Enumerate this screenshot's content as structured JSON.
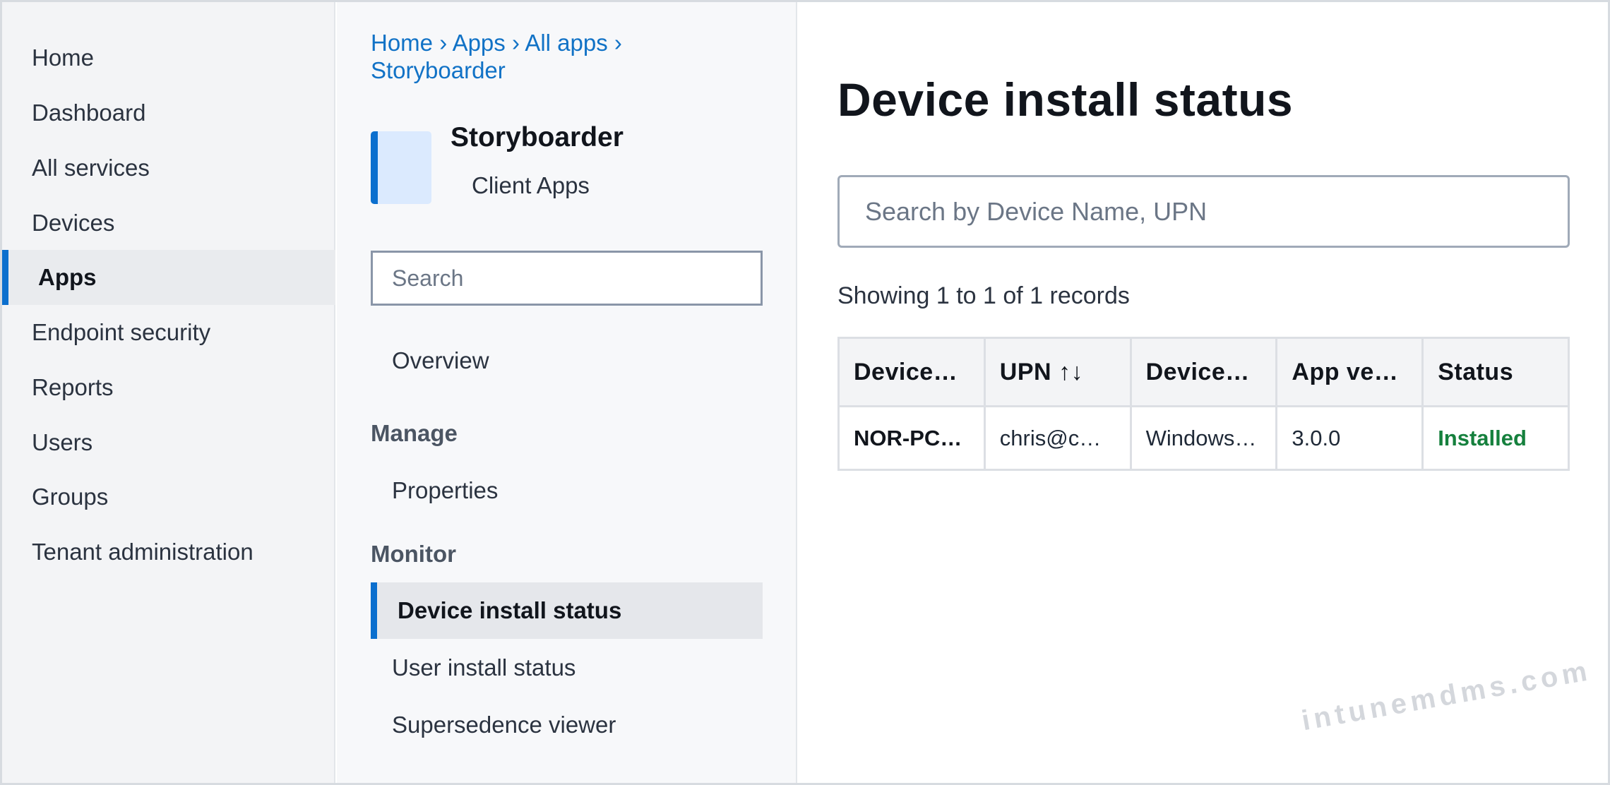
{
  "nav": {
    "items": [
      {
        "label": "Home"
      },
      {
        "label": "Dashboard"
      },
      {
        "label": "All services"
      },
      {
        "label": "Devices"
      },
      {
        "label": "Apps"
      },
      {
        "label": "Endpoint security"
      },
      {
        "label": "Reports"
      },
      {
        "label": "Users"
      },
      {
        "label": "Groups"
      },
      {
        "label": "Tenant administration"
      }
    ],
    "active": "Apps"
  },
  "blade": {
    "breadcrumb": {
      "items": [
        "Home",
        "Apps",
        "All apps",
        "Storyboarder"
      ],
      "separator": "›"
    },
    "app": {
      "name": "Storyboarder",
      "subtitle": "Client Apps",
      "icon": "app-tile-icon"
    },
    "search": {
      "placeholder": "Search"
    },
    "menu": {
      "overview": "Overview",
      "manage_heading": "Manage",
      "properties": "Properties",
      "monitor_heading": "Monitor",
      "device_install_status": "Device install status",
      "user_install_status": "User install status",
      "supersedence_viewer": "Supersedence viewer"
    }
  },
  "main": {
    "title": "Device install status",
    "search": {
      "placeholder": "Search by Device Name, UPN"
    },
    "records_text": "Showing 1 to 1 of 1 records",
    "table": {
      "columns": [
        "Device…",
        "UPN ↑↓",
        "Device…",
        "App ve…",
        "Status"
      ],
      "rows": [
        [
          "NOR-PC…",
          "chris@c…",
          "Windows…",
          "3.0.0",
          "Installed"
        ]
      ]
    }
  },
  "watermark": "intunemdms.com",
  "colors": {
    "accent": "#0b6fce",
    "link": "#1172c6",
    "status_installed": "#15803d"
  }
}
